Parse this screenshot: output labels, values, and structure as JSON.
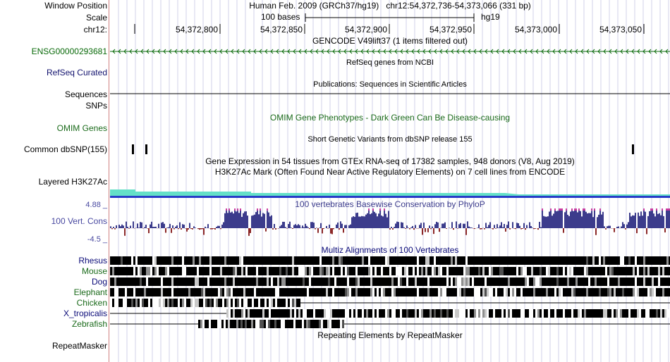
{
  "labels": {
    "window_position": "Window Position",
    "scale": "Scale",
    "chrom": "chr12:",
    "gencode_gene": "ENSG00000293681",
    "refseq": "RefSeq Curated",
    "sequences": "Sequences",
    "snps": "SNPs",
    "omim_genes": "OMIM Genes",
    "common_dbsnp": "Common dbSNP(155)",
    "layered": "Layered H3K27Ac",
    "cons_top": "4.88 _",
    "cons_label": "100 Vert. Cons",
    "cons_bottom": "-4.5 _",
    "species": [
      "Rhesus",
      "Mouse",
      "Dog",
      "Elephant",
      "Chicken",
      "X_tropicalis",
      "Zebrafish"
    ],
    "repeatmasker": "RepeatMasker"
  },
  "header": {
    "assembly": "Human Feb. 2009 (GRCh37/hg19)",
    "position": "chr12:54,372,736-54,373,066 (331 bp)",
    "scale_text": "100 bases",
    "scale_db": "hg19",
    "ruler_ticks": [
      "54,372,800",
      "54,372,850",
      "54,372,900",
      "54,372,950",
      "54,373,000",
      "54,373,050"
    ]
  },
  "tracks": {
    "gencode_title": "GENCODE V49lift37 (1 items filtered out)",
    "refseq_title": "RefSeq genes from NCBI",
    "pubs_title": "Publications: Sequences in Scientific Articles",
    "omim_title": "OMIM Gene Phenotypes - Dark Green Can Be Disease-causing",
    "dbsnp_title": "Short Genetic Variants from dbSNP release 155",
    "gtex_title": "Gene Expression in 54 tissues from GTEx RNA-seq of 17382 samples, 948 donors (V8, Aug 2019)",
    "h3k27ac_title": "H3K27Ac Mark (Often Found Near Active Regulatory Elements) on 7 cell lines from ENCODE",
    "phylop_title": "100 vertebrates Basewise Conservation by PhyloP",
    "multiz_title": "Multiz Alignments of 100 Vertebrates",
    "repeat_title": "Repeating Elements by RepeatMasker"
  },
  "colors": {
    "gencode": "#0a6a0a",
    "refseq": "#12126e",
    "omim": "#1a6a1a",
    "cons_label": "#4848a0",
    "cons_bar": "#3c3c8c",
    "cons_high": "#c83ca0",
    "cons_neg": "#8c2828",
    "species": "#0a0a78",
    "species_green": "#1a6a1a",
    "grid": "#d0d0e8",
    "h3k27ac": "#64e0c8",
    "h3k27ac_edge": "#283cc8",
    "divider": "#d08080"
  }
}
